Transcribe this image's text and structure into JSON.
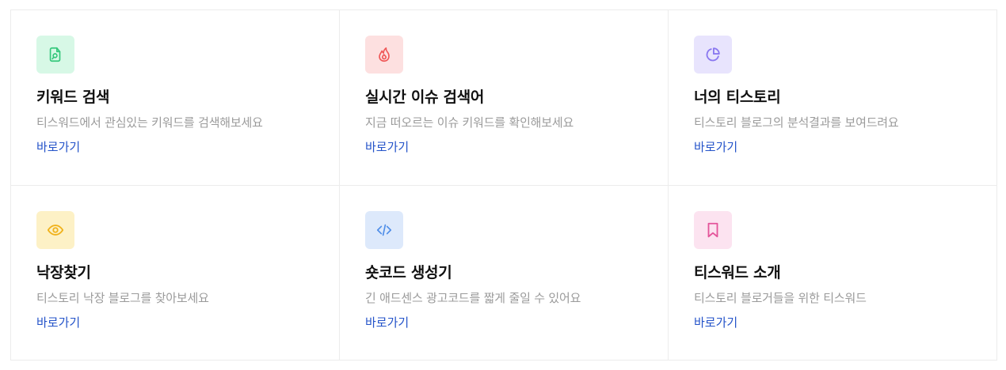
{
  "cards": [
    {
      "icon": "document-search-icon",
      "icon_bg": "#d7f8e6",
      "icon_color": "#34c77b",
      "title": "키워드 검색",
      "description": "티스워드에서 관심있는 키워드를 검색해보세요",
      "link": "바로가기"
    },
    {
      "icon": "fire-icon",
      "icon_bg": "#fde0e0",
      "icon_color": "#ef5757",
      "title": "실시간 이슈 검색어",
      "description": "지금 떠오르는 이슈 키워드를 확인해보세요",
      "link": "바로가기"
    },
    {
      "icon": "pie-chart-icon",
      "icon_bg": "#e8e4fd",
      "icon_color": "#8a78f0",
      "title": "너의 티스토리",
      "description": "티스토리 블로그의 분석결과를 보여드려요",
      "link": "바로가기"
    },
    {
      "icon": "eye-icon",
      "icon_bg": "#fdf1c6",
      "icon_color": "#f0b21c",
      "title": "낙장찾기",
      "description": "티스토리 낙장 블로그를 찾아보세요",
      "link": "바로가기"
    },
    {
      "icon": "code-icon",
      "icon_bg": "#dde9fb",
      "icon_color": "#4f8ee8",
      "title": "숏코드 생성기",
      "description": "긴 애드센스 광고코드를 짧게 줄일 수 있어요",
      "link": "바로가기"
    },
    {
      "icon": "bookmark-icon",
      "icon_bg": "#fce3f0",
      "icon_color": "#e4559b",
      "title": "티스워드 소개",
      "description": "티스토리 블로거들을 위한 티스워드",
      "link": "바로가기"
    }
  ]
}
